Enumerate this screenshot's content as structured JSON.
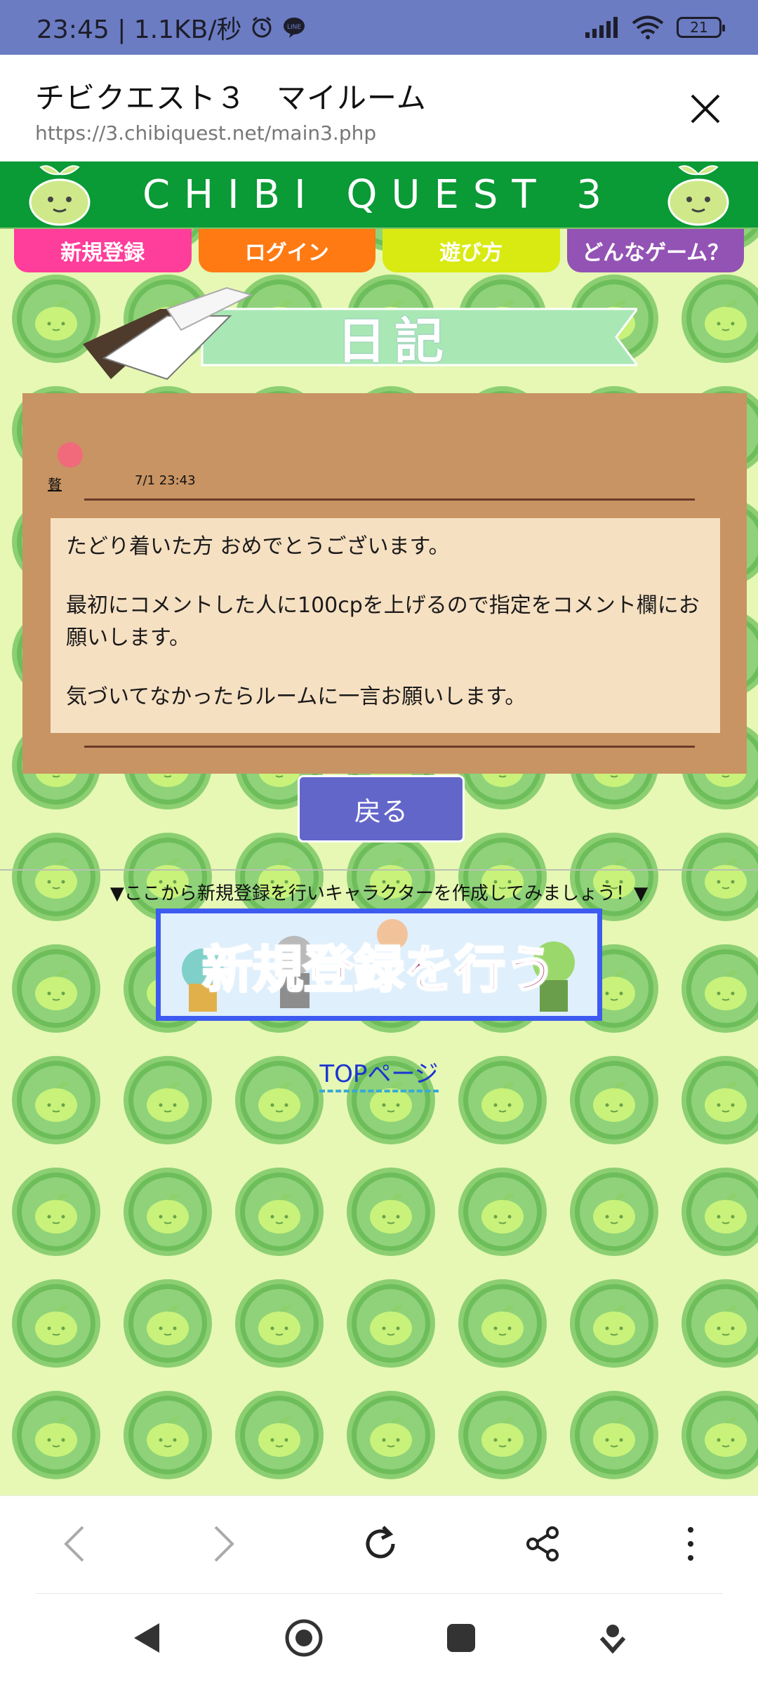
{
  "status_bar": {
    "time_text": "23:45 | 1.1KB/秒",
    "battery": "21"
  },
  "browser": {
    "title": "チビクエスト３　マイルーム",
    "url": "https://3.chibiquest.net/main3.php"
  },
  "site": {
    "brand": "CHIBI QUEST 3",
    "tabs": [
      {
        "label": "新規登録",
        "color": "#ff3d9a"
      },
      {
        "label": "ログイン",
        "color": "#ff7a12"
      },
      {
        "label": "遊び方",
        "color": "#d9ea12"
      },
      {
        "label": "どんなゲーム？",
        "color": "#9353b4"
      }
    ],
    "section_title": "日記"
  },
  "diary": {
    "author": "贅",
    "date": "7/1 23:43",
    "paragraphs": [
      "たどり着いた方 おめでとうございます。",
      "最初にコメントした人に100cpを上げるので指定をコメント欄にお願いします。",
      "気づいてなかったらルームに一言お願いします。"
    ]
  },
  "back_button": "戻る",
  "register": {
    "notice": "▼ここから新規登録を行いキャラクターを作成してみましょう！▼",
    "banner_label": "新規登録を行う"
  },
  "top_link": "TOPページ",
  "colors": {
    "accent": "#0a9a36",
    "card": "#c89463",
    "back_button": "#6366c9",
    "banner_border": "#3d5bf0"
  }
}
